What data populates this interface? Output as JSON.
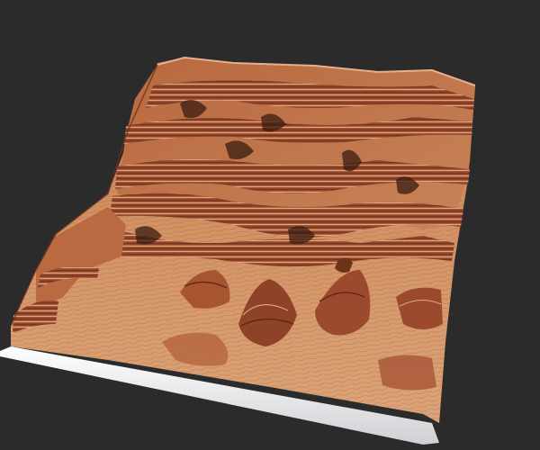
{
  "scene": {
    "subject": "terrain-heightmap",
    "colors": {
      "background": "#2b2b2b",
      "sand_light": "#d9a274",
      "sand_mid": "#c98a5e",
      "rock_red": "#a4502e",
      "rock_dark": "#5a2a1a",
      "shadow": "#3a1c12",
      "base_white": "#e8e8ea"
    }
  }
}
